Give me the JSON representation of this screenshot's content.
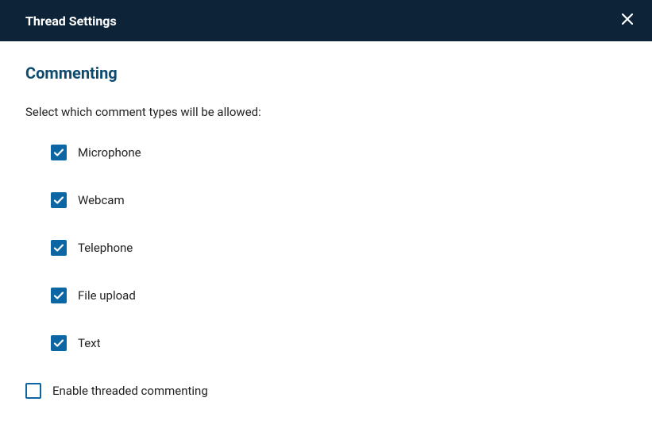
{
  "header": {
    "title": "Thread Settings"
  },
  "section": {
    "heading": "Commenting",
    "description": "Select which comment types will be allowed:"
  },
  "options": {
    "microphone": {
      "label": "Microphone",
      "checked": true
    },
    "webcam": {
      "label": "Webcam",
      "checked": true
    },
    "telephone": {
      "label": "Telephone",
      "checked": true
    },
    "fileupload": {
      "label": "File upload",
      "checked": true
    },
    "text": {
      "label": "Text",
      "checked": true
    }
  },
  "threaded": {
    "label": "Enable threaded commenting",
    "checked": false
  }
}
